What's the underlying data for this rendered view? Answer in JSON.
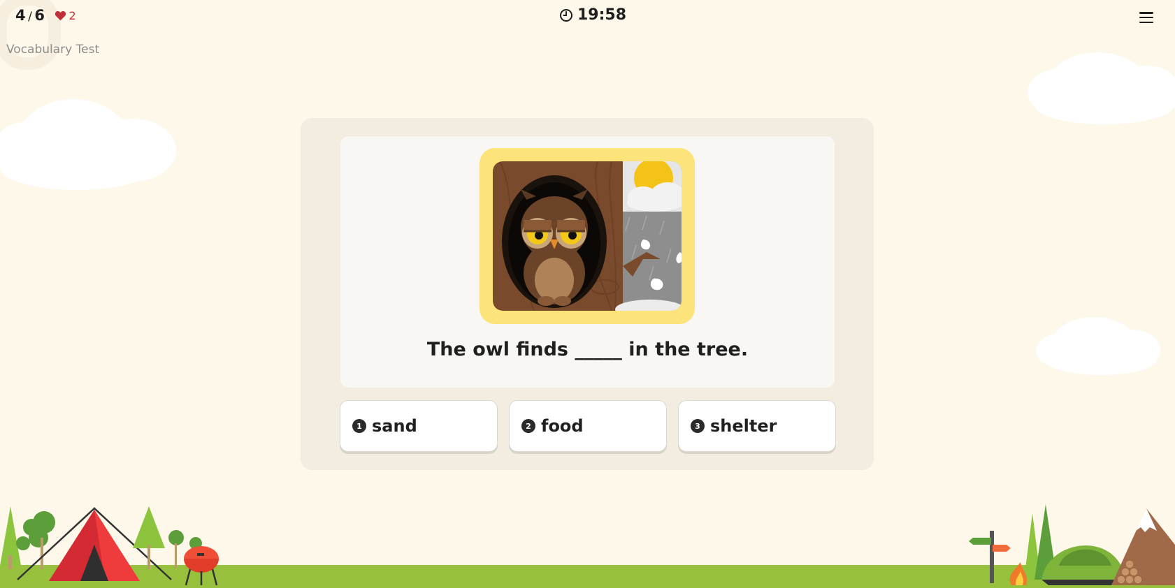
{
  "header": {
    "progress_current": "4",
    "progress_total": "6",
    "lives": "2",
    "subtitle": "Vocabulary Test",
    "timer": "19:58"
  },
  "question": {
    "image_icon": "owl-in-tree-hollow",
    "sentence": "The owl finds _____ in the tree."
  },
  "options": [
    {
      "number": "1",
      "label": "sand"
    },
    {
      "number": "2",
      "label": "food"
    },
    {
      "number": "3",
      "label": "shelter"
    }
  ],
  "colors": {
    "background": "#fef8ea",
    "frame": "#fce47a",
    "ground": "#97c13c",
    "heart": "#c0303b"
  }
}
